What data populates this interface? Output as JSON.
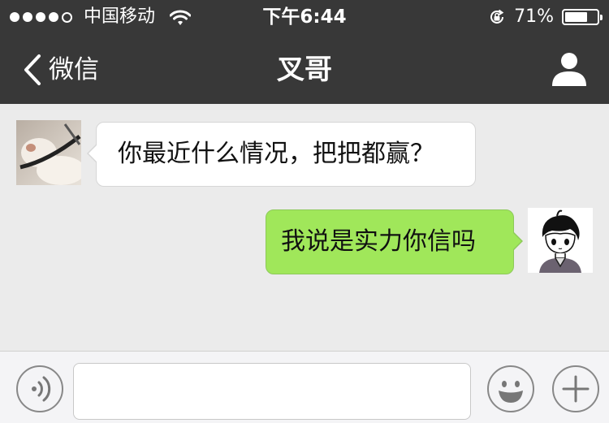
{
  "status_bar": {
    "carrier": "中国移动",
    "time": "下午6:44",
    "battery_percent": "71%",
    "battery_level": 0.71,
    "signal_bars": 4,
    "signal_total": 5,
    "icons": [
      "signal-dots-icon",
      "wifi-icon",
      "orientation-lock-icon",
      "battery-icon"
    ]
  },
  "nav": {
    "back_label": "微信",
    "title": "叉哥",
    "icons": [
      "back-chevron-icon",
      "person-icon"
    ]
  },
  "messages": [
    {
      "side": "left",
      "text": "你最近什么情况，把把都赢？",
      "avatar": "contact-avatar"
    },
    {
      "side": "right",
      "text": "我说是实力你信吗",
      "avatar": "self-avatar"
    }
  ],
  "input_bar": {
    "value": "",
    "placeholder": "",
    "icons": [
      "voice-icon",
      "emoji-icon",
      "plus-icon"
    ]
  },
  "colors": {
    "header_bg": "#383838",
    "chat_bg": "#ebebeb",
    "incoming_bubble": "#ffffff",
    "outgoing_bubble": "#a0e75a",
    "input_bar_bg": "#f4f4f6"
  }
}
